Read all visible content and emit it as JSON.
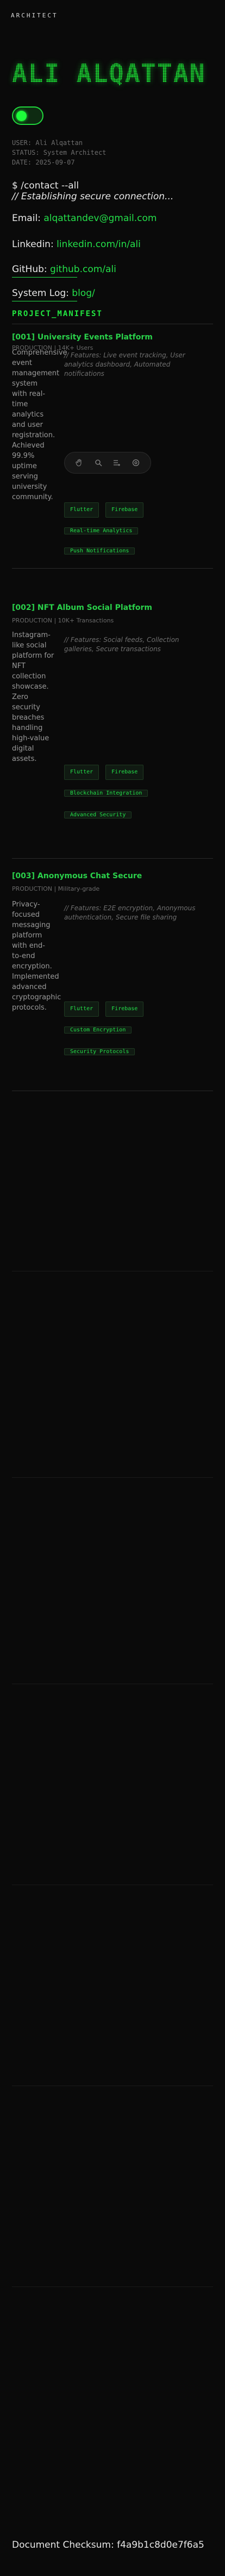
{
  "header": {
    "brand": "ARCHITECT"
  },
  "hero": {
    "title": "ALI ALQATTAN"
  },
  "profile": {
    "user": "USER: Ali Alqattan",
    "status": "STATUS: System Architect",
    "date": "DATE: 2025-09-07"
  },
  "terminal": {
    "command": "$ /contact --all",
    "comment": "// Establishing secure connection...",
    "email_label": "Email:",
    "email_value": "alqattandev@gmail.com",
    "linkedin_label": "Linkedin:",
    "linkedin_value": "linkedin.com/in/ali",
    "github_label": "GitHub:",
    "github_value": "github.com/ali",
    "syslog_label": "System Log:",
    "syslog_value": "blog/"
  },
  "manifest": {
    "title": "PROJECT_MANIFEST"
  },
  "projects": [
    {
      "title": "[001] University Events Platform",
      "tag": "PRODUCTION | 14K+ Users",
      "description": "Comprehensive event management system with real-time analytics and user registration. Achieved 99.9% uptime serving university community.",
      "features": "// Features: Live event tracking, User analytics dashboard, Automated notifications",
      "chips": [
        "Flutter",
        "Firebase",
        "Real-time Analytics",
        "Push Notifications"
      ]
    },
    {
      "title": "[002] NFT Album Social Platform",
      "tag": "PRODUCTION | 10K+ Transactions",
      "description": "Instagram-like social platform for NFT collection showcase. Zero security breaches handling high-value digital assets.",
      "features": "// Features: Social feeds, Collection galleries, Secure transactions",
      "chips": [
        "Flutter",
        "Firebase",
        "Blockchain Integration",
        "Advanced Security"
      ]
    },
    {
      "title": "[003] Anonymous Chat Secure",
      "tag": "PRODUCTION | Military-grade",
      "description": "Privacy-focused messaging platform with end-to-end encryption. Implemented advanced cryptographic protocols.",
      "features": "// Features: E2E encryption, Anonymous authentication, Secure file sharing",
      "chips": [
        "Flutter",
        "Firebase",
        "Custom Encryption",
        "Security Protocols"
      ]
    }
  ],
  "toolbar": {
    "icons": [
      "hand-icon",
      "search-icon",
      "list-icon",
      "settings-icon"
    ]
  },
  "footer": {
    "checksum": "Document Checksum: f4a9b1c8d0e7f6a5"
  },
  "colors": {
    "accent": "#1dfc3a",
    "background": "#0a0a0a"
  }
}
